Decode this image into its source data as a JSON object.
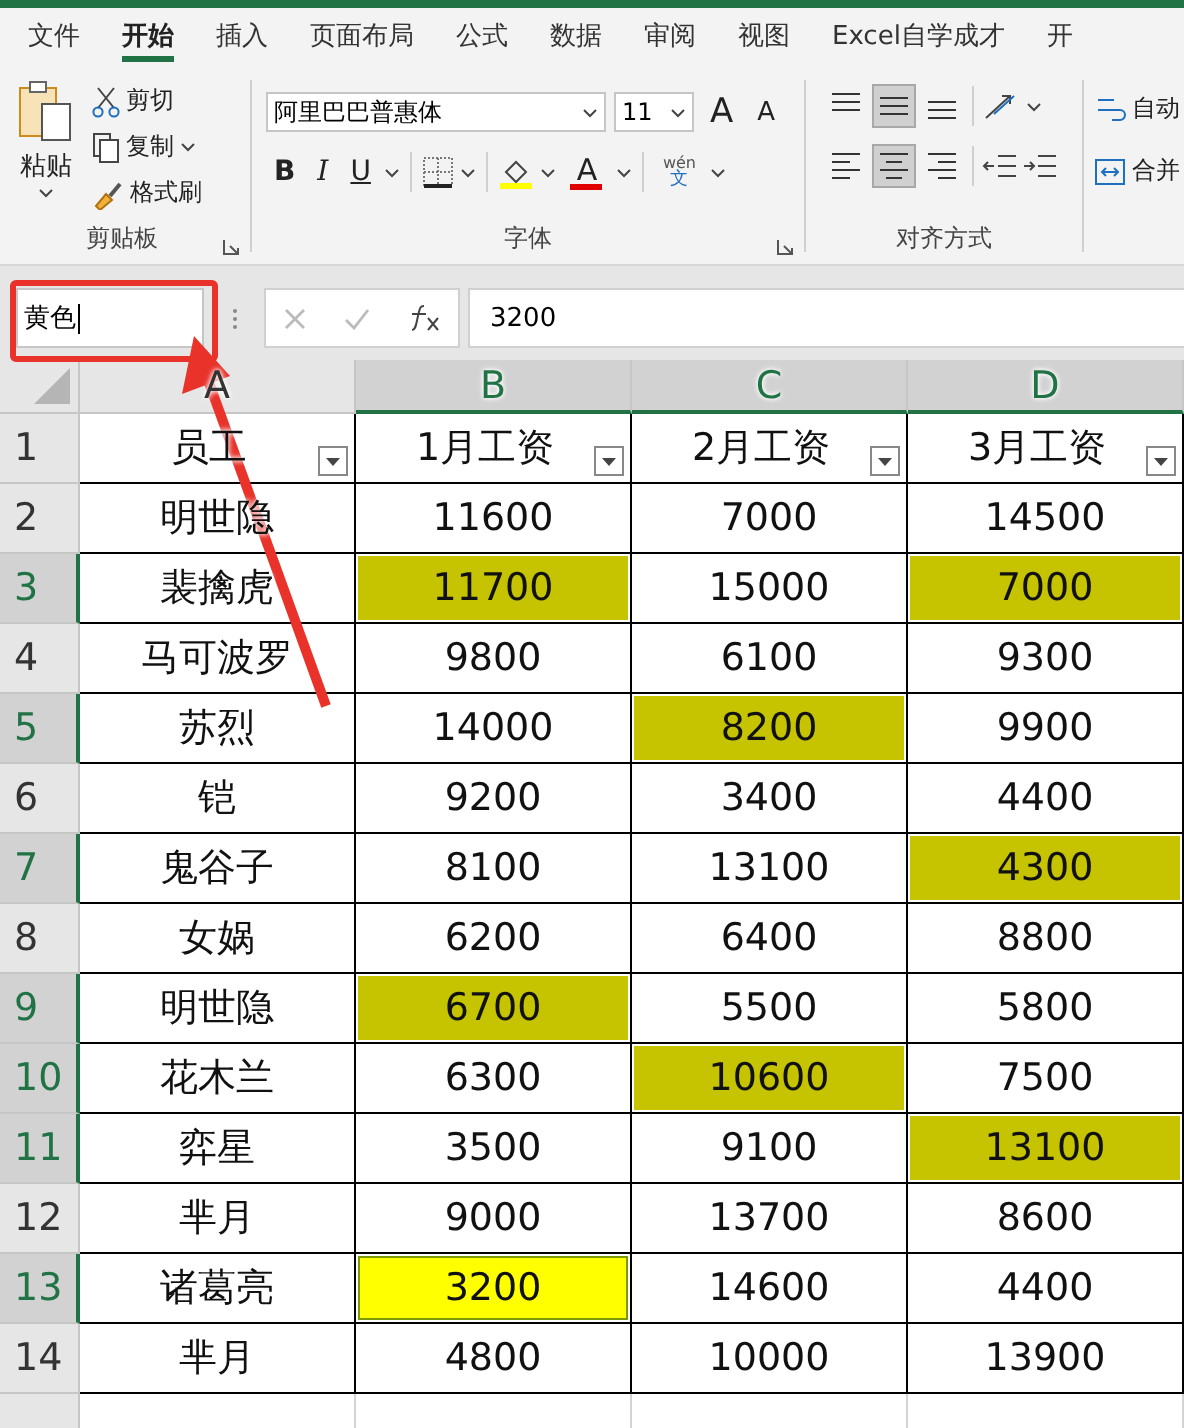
{
  "tabs": [
    {
      "label": "文件",
      "selected": false
    },
    {
      "label": "开始",
      "selected": true
    },
    {
      "label": "插入",
      "selected": false
    },
    {
      "label": "页面布局",
      "selected": false
    },
    {
      "label": "公式",
      "selected": false
    },
    {
      "label": "数据",
      "selected": false
    },
    {
      "label": "审阅",
      "selected": false
    },
    {
      "label": "视图",
      "selected": false
    },
    {
      "label": "Excel自学成才",
      "selected": false
    },
    {
      "label": "开",
      "selected": false
    }
  ],
  "clipboard": {
    "paste": "粘贴",
    "cut": "剪切",
    "copy": "复制",
    "format_painter": "格式刷",
    "label": "剪贴板"
  },
  "font": {
    "name": "阿里巴巴普惠体",
    "size": "11",
    "grow": "A",
    "shrink": "A",
    "bold": "B",
    "italic": "I",
    "underline": "U",
    "font_color": "A",
    "phonetic_top": "wén",
    "phonetic_bottom": "文",
    "label": "字体"
  },
  "alignment": {
    "buttons": [
      {
        "kind": "top",
        "pressed": false
      },
      {
        "kind": "middle",
        "pressed": true
      },
      {
        "kind": "bottom",
        "pressed": false
      },
      {
        "kind": "left",
        "pressed": false
      },
      {
        "kind": "center",
        "pressed": true
      },
      {
        "kind": "right",
        "pressed": false
      }
    ],
    "label": "对齐方式",
    "wrap": "自动",
    "merge": "合并"
  },
  "name_box": "黄色",
  "formula": "3200",
  "columns": [
    {
      "label": "A",
      "selected": false
    },
    {
      "label": "B",
      "selected": true
    },
    {
      "label": "C",
      "selected": true
    },
    {
      "label": "D",
      "selected": true
    }
  ],
  "rows": [
    {
      "number": "1",
      "selected": false,
      "kind": "header",
      "cells": [
        {
          "text": "员工",
          "selected": false,
          "active": false
        },
        {
          "text": "1月工资",
          "selected": false,
          "active": false
        },
        {
          "text": "2月工资",
          "selected": false,
          "active": false
        },
        {
          "text": "3月工资",
          "selected": false,
          "active": false
        }
      ]
    },
    {
      "number": "2",
      "selected": false,
      "kind": "data",
      "cells": [
        {
          "text": "明世隐",
          "selected": false,
          "active": false
        },
        {
          "text": "11600",
          "selected": false,
          "active": false
        },
        {
          "text": "7000",
          "selected": false,
          "active": false
        },
        {
          "text": "14500",
          "selected": false,
          "active": false
        }
      ]
    },
    {
      "number": "3",
      "selected": true,
      "kind": "data",
      "cells": [
        {
          "text": "裴擒虎",
          "selected": false,
          "active": false
        },
        {
          "text": "11700",
          "selected": true,
          "active": false
        },
        {
          "text": "15000",
          "selected": false,
          "active": false
        },
        {
          "text": "7000",
          "selected": true,
          "active": false
        }
      ]
    },
    {
      "number": "4",
      "selected": false,
      "kind": "data",
      "cells": [
        {
          "text": "马可波罗",
          "selected": false,
          "active": false
        },
        {
          "text": "9800",
          "selected": false,
          "active": false
        },
        {
          "text": "6100",
          "selected": false,
          "active": false
        },
        {
          "text": "9300",
          "selected": false,
          "active": false
        }
      ]
    },
    {
      "number": "5",
      "selected": true,
      "kind": "data",
      "cells": [
        {
          "text": "苏烈",
          "selected": false,
          "active": false
        },
        {
          "text": "14000",
          "selected": false,
          "active": false
        },
        {
          "text": "8200",
          "selected": true,
          "active": false
        },
        {
          "text": "9900",
          "selected": false,
          "active": false
        }
      ]
    },
    {
      "number": "6",
      "selected": false,
      "kind": "data",
      "cells": [
        {
          "text": "铠",
          "selected": false,
          "active": false
        },
        {
          "text": "9200",
          "selected": false,
          "active": false
        },
        {
          "text": "3400",
          "selected": false,
          "active": false
        },
        {
          "text": "4400",
          "selected": false,
          "active": false
        }
      ]
    },
    {
      "number": "7",
      "selected": true,
      "kind": "data",
      "cells": [
        {
          "text": "鬼谷子",
          "selected": false,
          "active": false
        },
        {
          "text": "8100",
          "selected": false,
          "active": false
        },
        {
          "text": "13100",
          "selected": false,
          "active": false
        },
        {
          "text": "4300",
          "selected": true,
          "active": false
        }
      ]
    },
    {
      "number": "8",
      "selected": false,
      "kind": "data",
      "cells": [
        {
          "text": "女娲",
          "selected": false,
          "active": false
        },
        {
          "text": "6200",
          "selected": false,
          "active": false
        },
        {
          "text": "6400",
          "selected": false,
          "active": false
        },
        {
          "text": "8800",
          "selected": false,
          "active": false
        }
      ]
    },
    {
      "number": "9",
      "selected": true,
      "kind": "data",
      "cells": [
        {
          "text": "明世隐",
          "selected": false,
          "active": false
        },
        {
          "text": "6700",
          "selected": true,
          "active": false
        },
        {
          "text": "5500",
          "selected": false,
          "active": false
        },
        {
          "text": "5800",
          "selected": false,
          "active": false
        }
      ]
    },
    {
      "number": "10",
      "selected": true,
      "kind": "data",
      "cells": [
        {
          "text": "花木兰",
          "selected": false,
          "active": false
        },
        {
          "text": "6300",
          "selected": false,
          "active": false
        },
        {
          "text": "10600",
          "selected": true,
          "active": false
        },
        {
          "text": "7500",
          "selected": false,
          "active": false
        }
      ]
    },
    {
      "number": "11",
      "selected": true,
      "kind": "data",
      "cells": [
        {
          "text": "弈星",
          "selected": false,
          "active": false
        },
        {
          "text": "3500",
          "selected": false,
          "active": false
        },
        {
          "text": "9100",
          "selected": false,
          "active": false
        },
        {
          "text": "13100",
          "selected": true,
          "active": false
        }
      ]
    },
    {
      "number": "12",
      "selected": false,
      "kind": "data",
      "cells": [
        {
          "text": "芈月",
          "selected": false,
          "active": false
        },
        {
          "text": "9000",
          "selected": false,
          "active": false
        },
        {
          "text": "13700",
          "selected": false,
          "active": false
        },
        {
          "text": "8600",
          "selected": false,
          "active": false
        }
      ]
    },
    {
      "number": "13",
      "selected": true,
      "kind": "data",
      "cells": [
        {
          "text": "诸葛亮",
          "selected": false,
          "active": false
        },
        {
          "text": "3200",
          "selected": true,
          "active": true
        },
        {
          "text": "14600",
          "selected": false,
          "active": false
        },
        {
          "text": "4400",
          "selected": false,
          "active": false
        }
      ]
    },
    {
      "number": "14",
      "selected": false,
      "kind": "data",
      "cells": [
        {
          "text": "芈月",
          "selected": false,
          "active": false
        },
        {
          "text": "4800",
          "selected": false,
          "active": false
        },
        {
          "text": "10000",
          "selected": false,
          "active": false
        },
        {
          "text": "13900",
          "selected": false,
          "active": false
        }
      ]
    }
  ]
}
